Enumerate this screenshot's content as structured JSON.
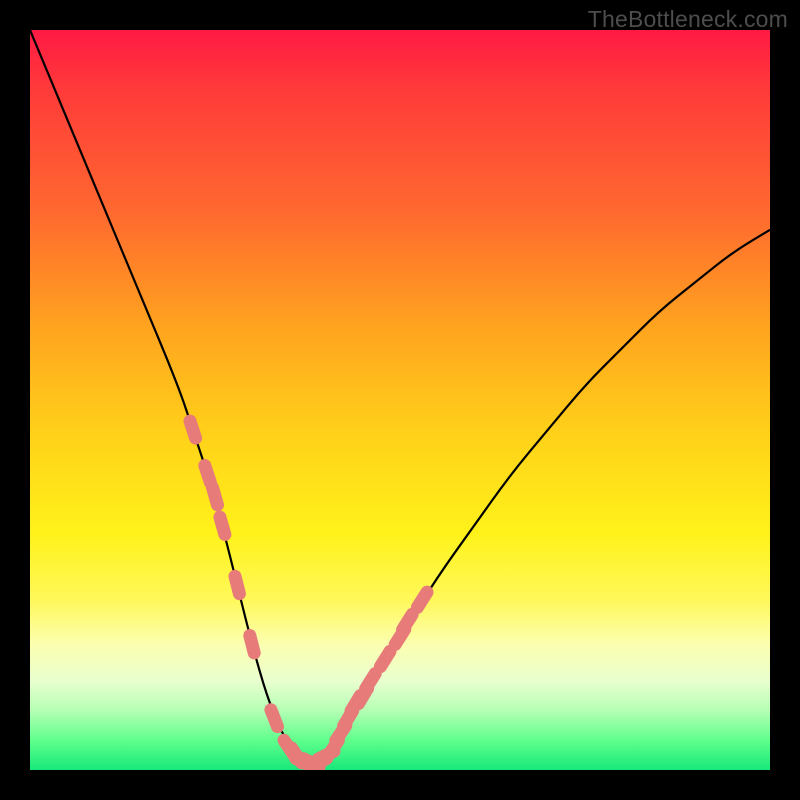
{
  "watermark": "TheBottleneck.com",
  "colors": {
    "background": "#000000",
    "curve": "#000000",
    "marker": "#e77b79",
    "gradient_top": "#ff1a44",
    "gradient_bottom": "#17e87a"
  },
  "chart_data": {
    "type": "line",
    "title": "",
    "xlabel": "",
    "ylabel": "",
    "xlim": [
      0,
      100
    ],
    "ylim": [
      0,
      100
    ],
    "grid": false,
    "series": [
      {
        "name": "bottleneck-curve",
        "x": [
          0,
          5,
          10,
          15,
          20,
          22,
          24,
          26,
          28,
          30,
          32,
          34,
          36,
          38,
          40,
          42,
          45,
          50,
          55,
          60,
          65,
          70,
          75,
          80,
          85,
          90,
          95,
          100
        ],
        "values": [
          100,
          88,
          76,
          64,
          52,
          46,
          40,
          33,
          25,
          17,
          10,
          5,
          2,
          1,
          2,
          5,
          10,
          18,
          26,
          33,
          40,
          46,
          52,
          57,
          62,
          66,
          70,
          73
        ]
      }
    ],
    "markers": {
      "name": "highlighted-points",
      "color": "#e77b79",
      "x": [
        22,
        24,
        25,
        26,
        28,
        30,
        33,
        35,
        36,
        37,
        38,
        39,
        40,
        41,
        42,
        43,
        44,
        45,
        46,
        48,
        50,
        51,
        53
      ],
      "values": [
        46,
        40,
        37,
        33,
        25,
        17,
        7,
        3,
        2,
        1,
        1,
        1,
        2,
        3,
        5,
        7,
        9,
        10,
        12,
        15,
        18,
        20,
        23
      ]
    }
  }
}
